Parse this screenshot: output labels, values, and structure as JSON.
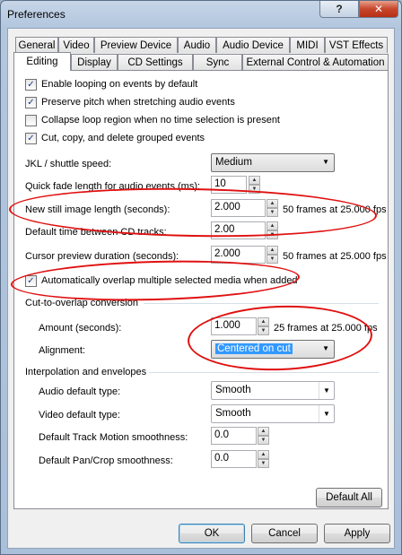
{
  "window": {
    "title": "Preferences",
    "help_glyph": "?",
    "close_glyph": "✕"
  },
  "tabs_row1": [
    "General",
    "Video",
    "Preview Device",
    "Audio",
    "Audio Device",
    "MIDI",
    "VST Effects"
  ],
  "tabs_row2": [
    "Editing",
    "Display",
    "CD Settings",
    "Sync",
    "External Control & Automation"
  ],
  "checkboxes": [
    {
      "label": "Enable looping on events by default",
      "checked": true
    },
    {
      "label": "Preserve pitch when stretching audio events",
      "checked": true
    },
    {
      "label": "Collapse loop region when no time selection is present",
      "checked": false
    },
    {
      "label": "Cut, copy, and delete grouped events",
      "checked": true
    }
  ],
  "jkl": {
    "label": "JKL / shuttle speed:",
    "value": "Medium"
  },
  "fade": {
    "label": "Quick fade length for audio events (ms):",
    "value": "10"
  },
  "still": {
    "label": "New still image length (seconds):",
    "value": "2.000",
    "info": "50 frames at 25.000 fps"
  },
  "cdtracks": {
    "label": "Default time between CD tracks:",
    "value": "2.00"
  },
  "cursor": {
    "label": "Cursor preview duration (seconds):",
    "value": "2.000",
    "info": "50 frames at 25.000 fps"
  },
  "overlap": {
    "label": "Automatically overlap multiple selected media when added",
    "checked": true
  },
  "cut_group": {
    "title": "Cut-to-overlap conversion",
    "amount_label": "Amount (seconds):",
    "amount_value": "1.000",
    "amount_info": "25 frames at 25.000 fps",
    "align_label": "Alignment:",
    "align_value": "Centered on cut"
  },
  "interp_group": {
    "title": "Interpolation and envelopes",
    "audio_label": "Audio default type:",
    "audio_value": "Smooth",
    "video_label": "Video default type:",
    "video_value": "Smooth",
    "track_label": "Default Track Motion smoothness:",
    "track_value": "0.0",
    "pan_label": "Default Pan/Crop smoothness:",
    "pan_value": "0.0"
  },
  "buttons": {
    "default_all": "Default All",
    "ok": "OK",
    "cancel": "Cancel",
    "apply": "Apply"
  },
  "icons": {
    "checkmark": "✓",
    "combo_arrow": "▼",
    "spin_up": "▲",
    "spin_down": "▼"
  },
  "colors": {
    "annotation": "#e01010",
    "selection": "#3399ff",
    "frame": "#aabfd9"
  }
}
